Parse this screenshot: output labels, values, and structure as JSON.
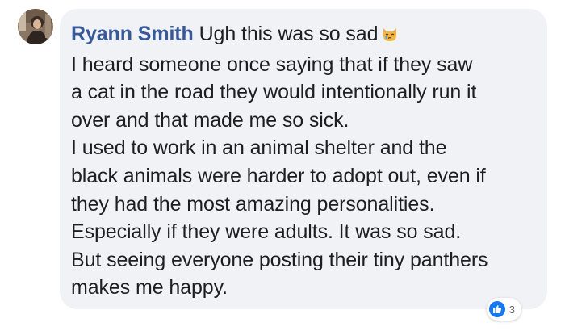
{
  "comment": {
    "author": "Ryann Smith",
    "first_line": "Ugh this was so sad",
    "emoji": "crying-cat-face-emoji",
    "body_lines": [
      "I heard someone once saying that if they saw",
      "a cat in the road they would intentionally run it",
      "over and that made me so sick.",
      "I used to work in an animal shelter and the",
      "black animals were harder to adopt out, even if",
      "they had the most amazing personalities.",
      "Especially if they were adults. It was so sad.",
      "But seeing everyone posting their tiny panthers",
      "makes me happy."
    ]
  },
  "reactions": {
    "icon": "like-icon",
    "count": "3"
  },
  "colors": {
    "author": "#385898",
    "bubble": "#f0f2f5",
    "text": "#1c1e21",
    "like": "#1877f2"
  }
}
